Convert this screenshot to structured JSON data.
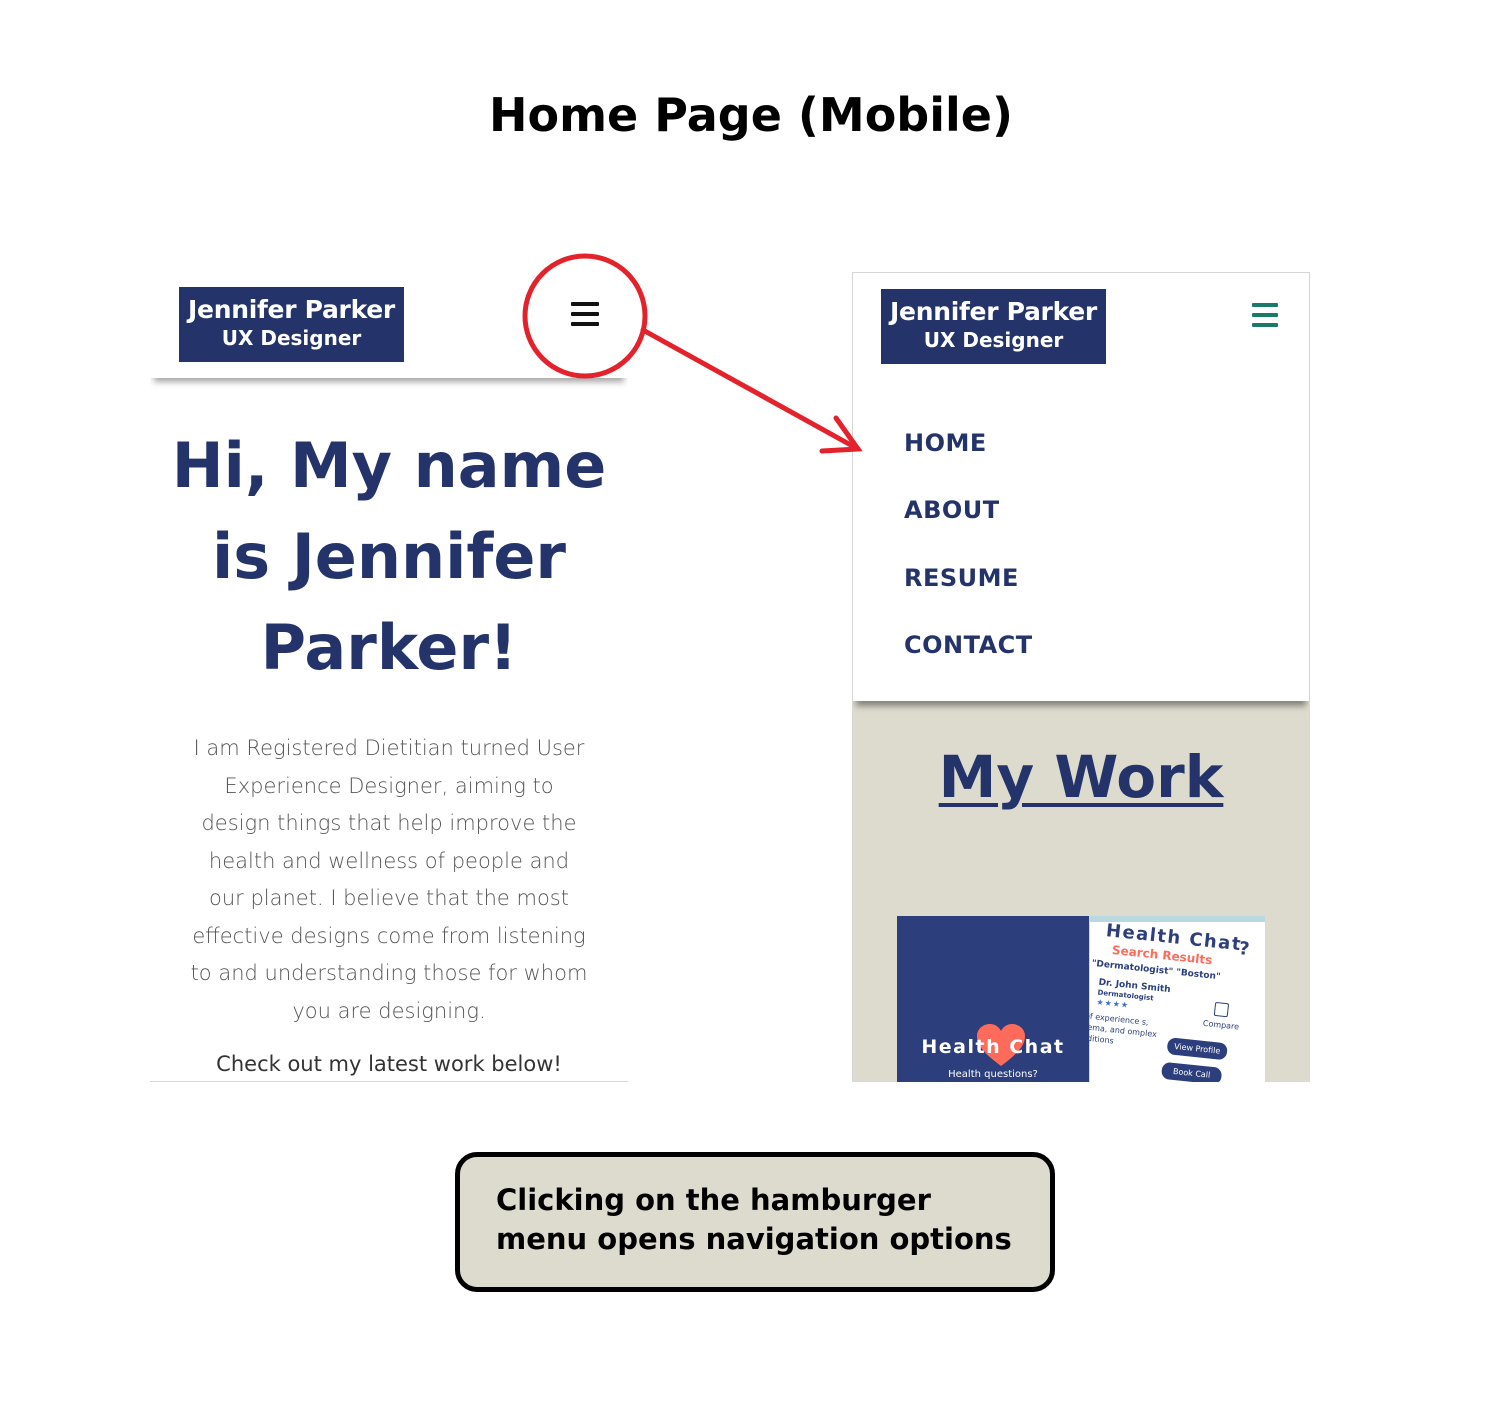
{
  "page": {
    "title": "Home Page (Mobile)"
  },
  "logo": {
    "name": "Jennifer Parker",
    "role": "UX Designer"
  },
  "left_screen": {
    "heading": "Hi, My name is Jennifer Parker!",
    "intro": "I am Registered Dietitian turned User Experience Designer, aiming to design things that help improve the health and wellness of people and our planet. I believe that the most effective designs come from listening to and understanding those for whom you are designing.",
    "cta": "Check out my latest work below!",
    "menu_icon": "hamburger-icon",
    "menu_icon_color": "#111111"
  },
  "right_screen": {
    "menu_icon": "hamburger-icon",
    "menu_icon_color": "#1a7a6a",
    "nav": [
      {
        "label": "HOME"
      },
      {
        "label": "ABOUT"
      },
      {
        "label": "RESUME"
      },
      {
        "label": "CONTACT"
      }
    ],
    "section_title": "My Work",
    "card": {
      "brand": "Health Chat",
      "tagline": "Health questions?",
      "preview": {
        "title": "Health Chat",
        "help": "?",
        "subtitle": "Search Results",
        "query": "r: \"Dermatologist\" \"Boston\"",
        "doctor": "Dr. John Smith",
        "specialty": "Dermatologist",
        "stars": "★★★★",
        "experience": "rs of experience s, eczema, and omplex conditions",
        "compare": "Compare",
        "view_profile": "View Profile",
        "book_call": "Book Call"
      }
    }
  },
  "annotation": {
    "callout_color": "#e3222b",
    "caption": "Clicking on the hamburger menu opens navigation options"
  },
  "colors": {
    "brand_navy": "#24346b",
    "work_bg": "#dddbcd",
    "accent_coral": "#ff6b5a"
  }
}
